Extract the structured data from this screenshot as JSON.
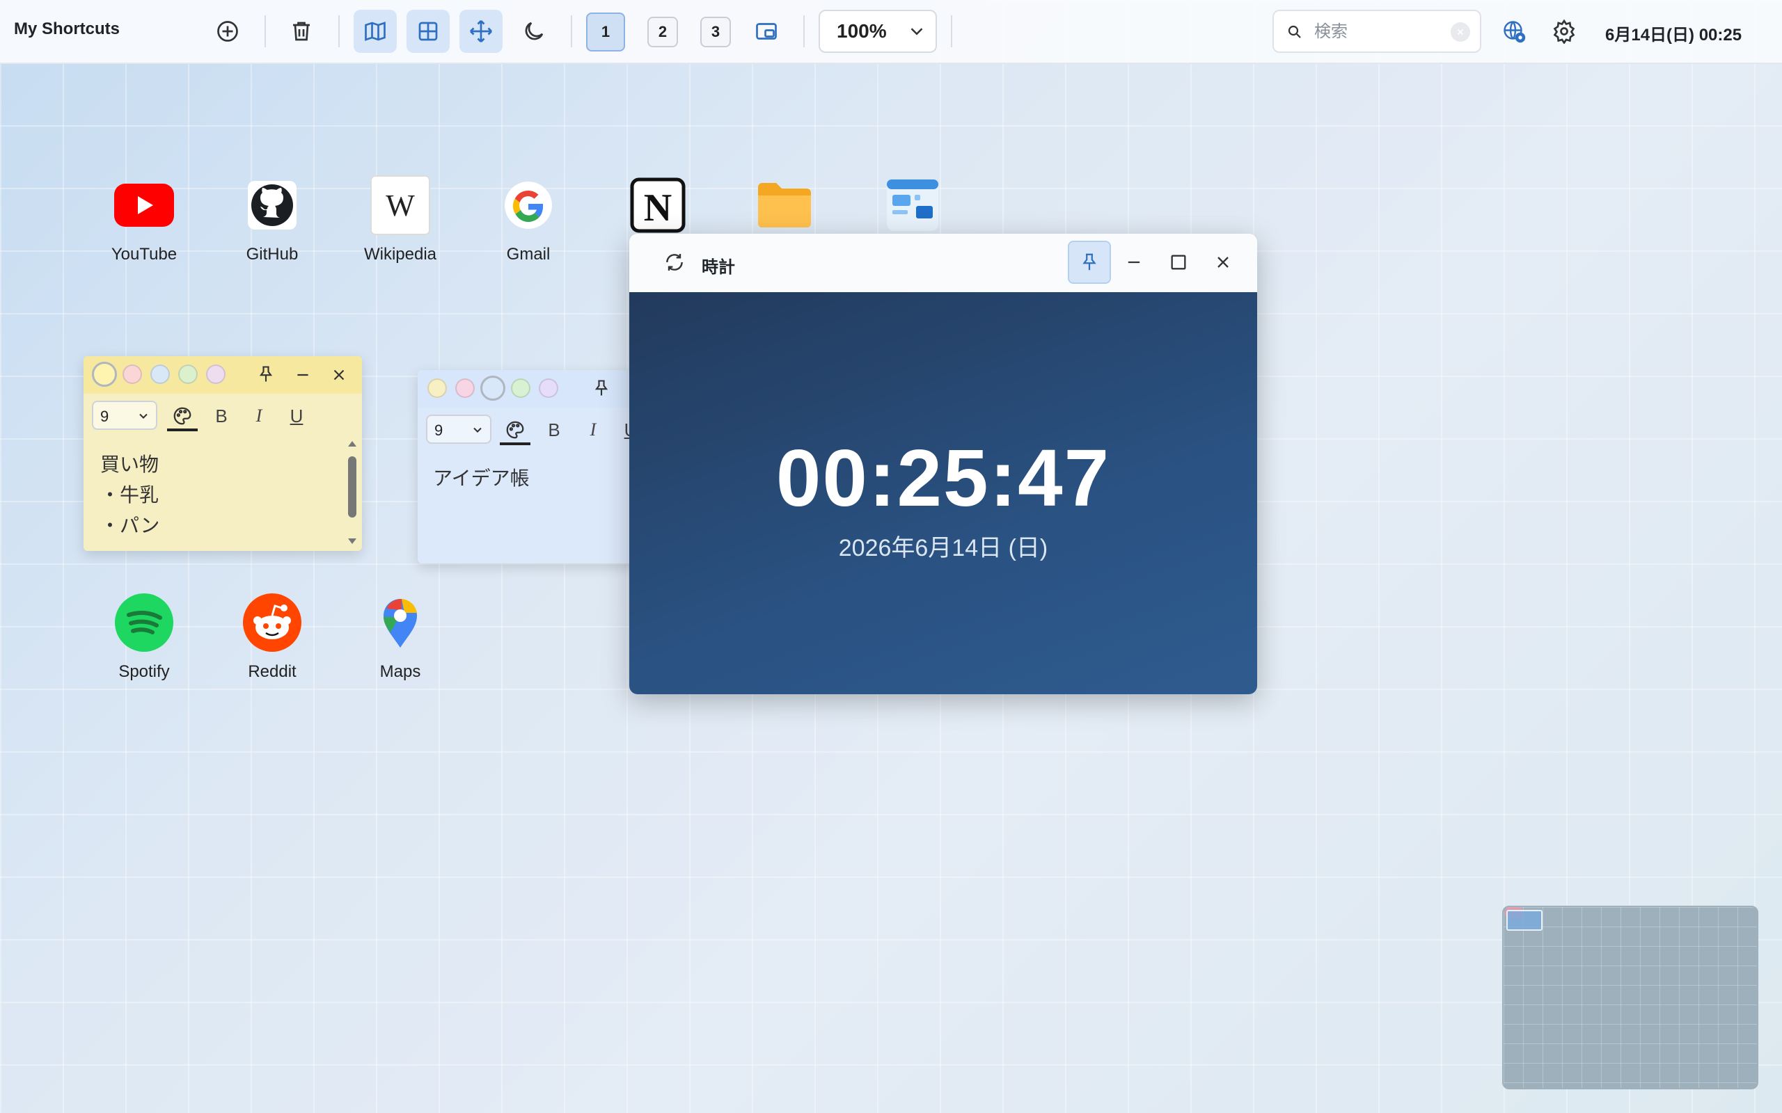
{
  "app": {
    "title": "My Shortcuts"
  },
  "toolbar": {
    "pages": [
      "1",
      "2",
      "3"
    ],
    "active_page": "1",
    "zoom": "100%",
    "search_placeholder": "検索",
    "datetime": "6月14日(日) 00:25",
    "icons": [
      "add-icon",
      "trash-icon",
      "map-icon",
      "grid-icon",
      "move-icon",
      "moon-icon",
      "pip-icon",
      "chevron-down-icon",
      "search-icon",
      "globe-icon",
      "gear-icon"
    ]
  },
  "shortcuts": [
    {
      "label": "YouTube",
      "icon": "youtube-icon"
    },
    {
      "label": "GitHub",
      "icon": "github-icon"
    },
    {
      "label": "Wikipedia",
      "icon": "wikipedia-icon"
    },
    {
      "label": "Gmail",
      "icon": "google-icon"
    },
    {
      "label": "",
      "icon": "notion-icon"
    },
    {
      "label": "",
      "icon": "folder-icon"
    },
    {
      "label": "",
      "icon": "dashboard-app-icon"
    },
    {
      "label": "Spotify",
      "icon": "spotify-icon"
    },
    {
      "label": "Reddit",
      "icon": "reddit-icon"
    },
    {
      "label": "Maps",
      "icon": "maps-pin-icon"
    }
  ],
  "notes": [
    {
      "font_size": "9",
      "text": "買い物\n・牛乳\n・パン",
      "color": "#f6efc4",
      "header_color": "#f7e89f"
    },
    {
      "font_size": "9",
      "text": "アイデア帳",
      "color": "#dce9fb",
      "header_color": "#d7e6fb"
    }
  ],
  "clock_window": {
    "title": "時計",
    "time": "00:25:47",
    "date": "2026年6月14日 (日)"
  },
  "colors": {
    "accent": "#2f6fc1",
    "active_bg": "#d6e6f8",
    "clock_bg": "#264870"
  }
}
